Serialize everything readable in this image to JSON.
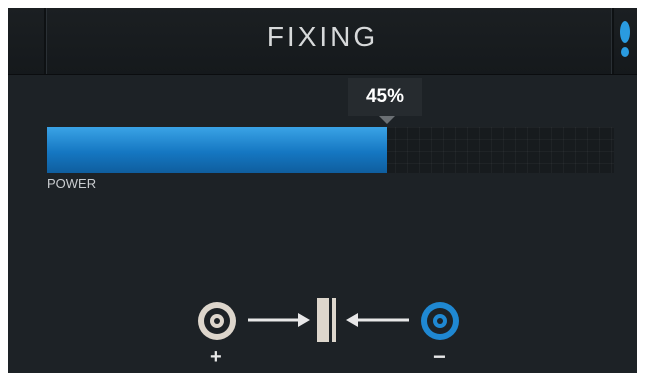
{
  "header": {
    "title": "FIXING",
    "foot_icon": "footprint-icon",
    "foot_color": "#2a9be0"
  },
  "power": {
    "percent_text": "45%",
    "level": 0.6,
    "label": "POWER",
    "bar_color": "#1f88d2"
  },
  "diagram": {
    "positive_sign": "+",
    "negative_sign": "−",
    "left_electrode_icon": "ring-electrode-icon",
    "right_electrode_icon": "ring-electrode-icon",
    "left_arrow_icon": "arrow-right-icon",
    "right_arrow_icon": "arrow-left-icon",
    "center_icon": "double-bar-icon",
    "positive_color": "#ddd6cc",
    "negative_color": "#1f88d2"
  }
}
